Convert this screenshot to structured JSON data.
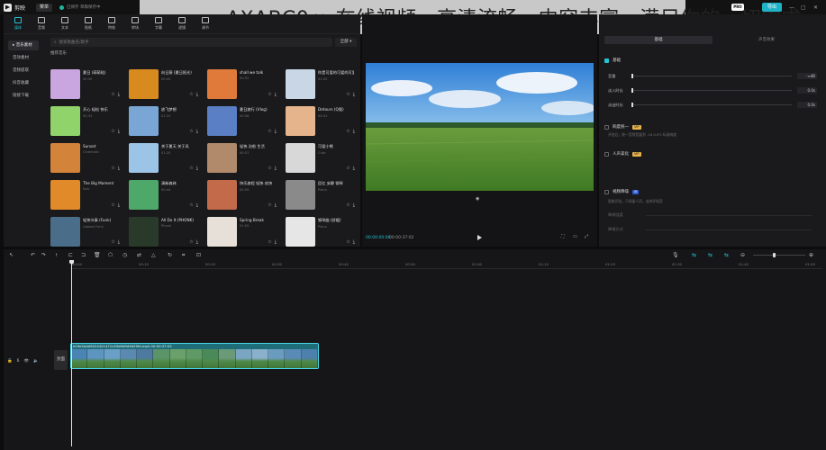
{
  "app": {
    "name": "剪映",
    "menu_label": "菜单",
    "autosave": "已保存 草稿保存中"
  },
  "banner": {
    "text": "AXABC0m 在线视频，高清流畅，内容丰富，满足你的一切需求"
  },
  "header": {
    "pro_badge": "PRO",
    "export_label": "导出",
    "win_min": "—",
    "win_max": "▢",
    "win_close": "✕"
  },
  "media": {
    "tabs": [
      {
        "label": "媒体",
        "icon": "media-icon",
        "active": true
      },
      {
        "label": "音频",
        "icon": "audio-icon",
        "active": false
      },
      {
        "label": "文本",
        "icon": "text-icon",
        "active": false
      },
      {
        "label": "贴纸",
        "icon": "sticker-icon",
        "active": false
      },
      {
        "label": "特效",
        "icon": "effects-icon",
        "active": false
      },
      {
        "label": "转场",
        "icon": "transition-icon",
        "active": false
      },
      {
        "label": "字幕",
        "icon": "caption-icon",
        "active": false
      },
      {
        "label": "滤镜",
        "icon": "filter-icon",
        "active": false
      },
      {
        "label": "调节",
        "icon": "adjust-icon",
        "active": false
      }
    ],
    "sidebar": [
      "▸ 音乐素材",
      "音效素材",
      "音频提取",
      "抖音收藏",
      "链接下载"
    ],
    "search_placeholder": "搜索歌曲名/歌手",
    "filter_label": "全部 ▾",
    "section_title": "推荐音乐",
    "cards": [
      {
        "title": "夏日 (萌萌哒)",
        "sub": "00:30",
        "color": "#c9a6e0"
      },
      {
        "title": "向日葵 (夏日阳光)",
        "sub": "00:45",
        "color": "#d98a1f"
      },
      {
        "title": "shall we talk",
        "sub": "00:52",
        "color": "#e07a3a"
      },
      {
        "title": "你是可爱的可爱的可爱",
        "sub": "01:02",
        "color": "#c8d6e6"
      },
      {
        "title": "开心 轻松 快乐",
        "sub": "00:33",
        "color": "#8fd36a"
      },
      {
        "title": "放飞梦想",
        "sub": "01:10",
        "color": "#7aa6d6"
      },
      {
        "title": "夏日旅行 (Vlog)",
        "sub": "00:58",
        "color": "#5a7fc4"
      },
      {
        "title": "Detours (Q版)",
        "sub": "00:41",
        "color": "#e6b48c"
      },
      {
        "title": "Sunset",
        "sub": "Cinematic",
        "color": "#d4833a"
      },
      {
        "title": "关于夏天 关于风",
        "sub": "01:20",
        "color": "#9cc4e6"
      },
      {
        "title": "轻快 治愈 生活",
        "sub": "00:37",
        "color": "#b08a6a"
      },
      {
        "title": "可爱小熊",
        "sub": "Cute",
        "color": "#d8d8d8"
      },
      {
        "title": "The Big Moment",
        "sub": "Epic",
        "color": "#e08a2a"
      },
      {
        "title": "清新森林",
        "sub": "00:44",
        "color": "#4ea86a"
      },
      {
        "title": "快乐旅程 轻快 欢快",
        "sub": "00:50",
        "color": "#c26a4a"
      },
      {
        "title": "回忆 安静 钢琴",
        "sub": "Piano",
        "color": "#8a8a8a"
      },
      {
        "title": "轻快节奏 (Funk)",
        "sub": "Upbeat Funk",
        "color": "#4a6e8a"
      },
      {
        "title": "All Do It (PHONK)",
        "sub": "Phonk",
        "color": "#2a3a2a"
      },
      {
        "title": "Spring Break",
        "sub": "01:05",
        "color": "#e6e0d8"
      },
      {
        "title": "钢琴曲 (舒缓)",
        "sub": "Piano",
        "color": "#e6e6e6"
      }
    ],
    "card_actions": [
      "☆",
      "⤓"
    ]
  },
  "player": {
    "current_time": "00:00:00:00",
    "total_time": "00:00:37:02",
    "fullscreen_icon": "⛶",
    "ratio_icon": "▭"
  },
  "inspector": {
    "tabs": [
      "基础",
      "声音效果"
    ],
    "sections": {
      "basic": "基础",
      "volume": "音量",
      "volume_val": "-∞dB",
      "fade_in": "淡入时长",
      "fade_in_val": "0.0s",
      "fade_out": "淡出时长",
      "fade_out_val": "0.0s",
      "noise": "响度统一",
      "noise_note": "开启后，统一音频音量到 -16 LUFS 标准响度",
      "voice": "人声美化",
      "voice_tag": "VIP",
      "separate": "视频降噪",
      "separate_tag": "AI",
      "separate_note": "智能识别，只保留人声，去除环境音",
      "sub_a": "降噪强度",
      "sub_b": "降噪方式",
      "vip_tag": "VIP"
    }
  },
  "timeline": {
    "ticks": [
      "00:00",
      "00:10",
      "00:20",
      "00:30",
      "00:40",
      "00:50",
      "01:00",
      "01:10",
      "01:20",
      "01:30",
      "01:40",
      "01:50"
    ],
    "track_label": "6",
    "cover_label": "封面",
    "clip_title": "e19e2add9024421471c49d9d9d9d29fd.mp4   00:00:37:02",
    "clip_colors": [
      "#4a84b4",
      "#5d94c0",
      "#6aa0c8",
      "#5a8ab0",
      "#4e7aa0",
      "#5a9468",
      "#6aa06a",
      "#5f9a66",
      "#4a8a5a",
      "#6a9a78",
      "#7aa6c4",
      "#8ab0cc",
      "#6a9cc0",
      "#5a8ab6",
      "#4e80ae"
    ]
  }
}
